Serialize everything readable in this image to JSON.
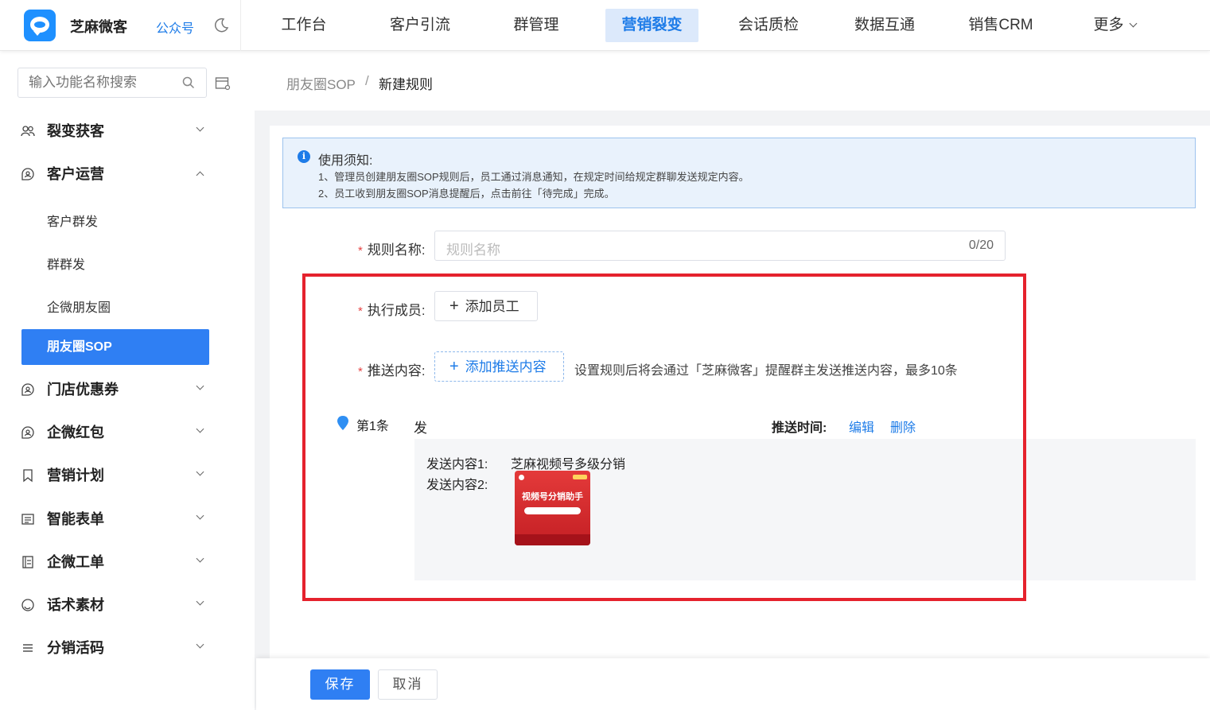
{
  "header": {
    "brand": "芝麻微客",
    "account_link": "公众号",
    "nav": [
      "工作台",
      "客户引流",
      "群管理",
      "营销裂变",
      "会话质检",
      "数据互通",
      "销售CRM",
      "更多"
    ],
    "active_nav": "营销裂变"
  },
  "sidebar": {
    "search_placeholder": "输入功能名称搜索",
    "menu": [
      {
        "label": "裂变获客",
        "icon": "users-icon",
        "expanded": false
      },
      {
        "label": "客户运营",
        "icon": "chat-people-icon",
        "expanded": true
      },
      {
        "label": "门店优惠券",
        "icon": "coupon-icon",
        "expanded": false
      },
      {
        "label": "企微红包",
        "icon": "redpacket-icon",
        "expanded": false
      },
      {
        "label": "营销计划",
        "icon": "bookmark-icon",
        "expanded": false
      },
      {
        "label": "智能表单",
        "icon": "form-icon",
        "expanded": false
      },
      {
        "label": "企微工单",
        "icon": "ticket-icon",
        "expanded": false
      },
      {
        "label": "话术素材",
        "icon": "circle-icon",
        "expanded": false
      },
      {
        "label": "分销活码",
        "icon": "list-icon",
        "expanded": false
      }
    ],
    "sub_items": [
      "客户群发",
      "群群发",
      "企微朋友圈",
      "朋友圈SOP"
    ],
    "active_sub": "朋友圈SOP"
  },
  "breadcrumb": {
    "parent": "朋友圈SOP",
    "separator": "/",
    "current": "新建规则"
  },
  "notice": {
    "title": "使用须知:",
    "lines": [
      "1、管理员创建朋友圈SOP规则后，员工通过消息通知，在规定时间给规定群聊发送规定内容。",
      "2、员工收到朋友圈SOP消息提醒后，点击前往「待完成」完成。"
    ]
  },
  "form": {
    "required_mark": "*",
    "rule_name_label": "规则名称:",
    "rule_name_placeholder": "规则名称",
    "rule_name_count": "0/20",
    "members_label": "执行成员:",
    "add_member_button": "添加员工",
    "content_label": "推送内容:",
    "add_content_button": "添加推送内容",
    "content_hint": "设置规则后将会通过「芝麻微客」提醒群主发送推送内容，最多10条",
    "plus_glyph": "+"
  },
  "push_items": [
    {
      "title": "第1条",
      "action": "发",
      "push_time_label": "推送时间:",
      "edit_label": "编辑",
      "delete_label": "删除",
      "content1_label": "发送内容1:",
      "content1_value": "芝麻视频号多级分销",
      "content2_label": "发送内容2:",
      "thumbnail_title": "视频号分销助手"
    }
  ],
  "footer": {
    "save_label": "保存",
    "cancel_label": "取消"
  },
  "colors": {
    "accent": "#2f7ff3",
    "highlight_border": "#e5222d",
    "required": "#e64545"
  }
}
